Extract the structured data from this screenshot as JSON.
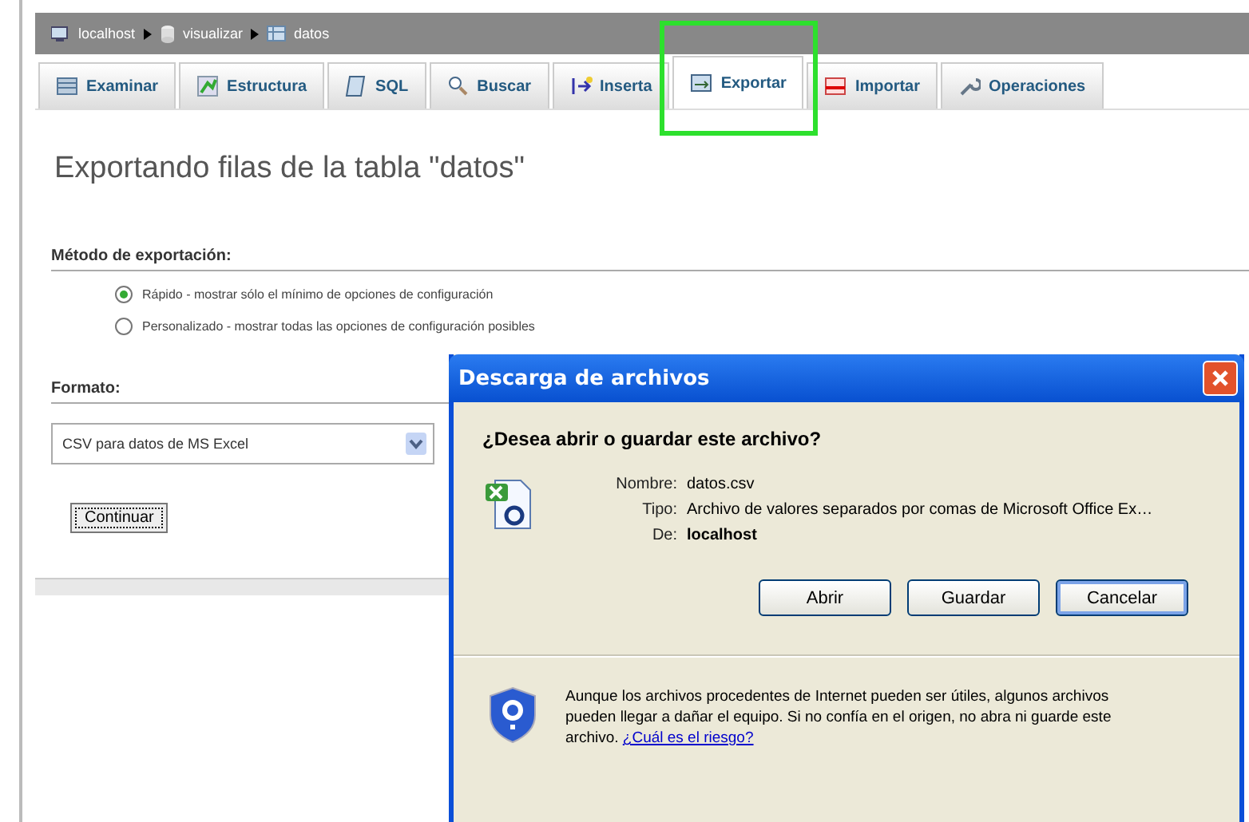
{
  "breadcrumb": [
    {
      "kind": "server",
      "label": "localhost"
    },
    {
      "kind": "database",
      "label": "visualizar"
    },
    {
      "kind": "table",
      "label": "datos"
    }
  ],
  "tabs": [
    {
      "kind": "browse",
      "label": "Examinar",
      "selected": false
    },
    {
      "kind": "structure",
      "label": "Estructura",
      "selected": false
    },
    {
      "kind": "sql",
      "label": "SQL",
      "selected": false
    },
    {
      "kind": "search",
      "label": "Buscar",
      "selected": false
    },
    {
      "kind": "insert",
      "label": "Inserta",
      "selected": false
    },
    {
      "kind": "export",
      "label": "Exportar",
      "selected": true
    },
    {
      "kind": "import",
      "label": "Importar",
      "selected": false
    },
    {
      "kind": "operations",
      "label": "Operaciones",
      "selected": false
    }
  ],
  "heading": "Exportando filas de la tabla \"datos\"",
  "method": {
    "label": "Método de exportación:",
    "options": [
      {
        "label": "Rápido - mostrar sólo el mínimo de opciones de configuración",
        "selected": true
      },
      {
        "label": "Personalizado - mostrar todas las opciones de configuración posibles",
        "selected": false
      }
    ]
  },
  "format": {
    "label": "Formato:",
    "value": "CSV para datos de MS Excel"
  },
  "continue_button": "Continuar",
  "dialog": {
    "title": "Descarga de archivos",
    "question": "¿Desea abrir o guardar este archivo?",
    "fields": [
      {
        "label": "Nombre:",
        "value": "datos.csv",
        "bold": false
      },
      {
        "label": "Tipo:",
        "value": "Archivo de valores separados por comas de Microsoft Office Ex…",
        "bold": false
      },
      {
        "label": "De:",
        "value": "localhost",
        "bold": true
      }
    ],
    "buttons": [
      {
        "label": "Abrir",
        "focused": false
      },
      {
        "label": "Guardar",
        "focused": false
      },
      {
        "label": "Cancelar",
        "focused": true
      }
    ],
    "warning": "Aunque los archivos procedentes de Internet pueden ser útiles, algunos archivos pueden llegar a dañar el equipo. Si no confía en el origen, no abra ni guarde este archivo.",
    "risk_link": "¿Cuál es el riesgo?"
  }
}
